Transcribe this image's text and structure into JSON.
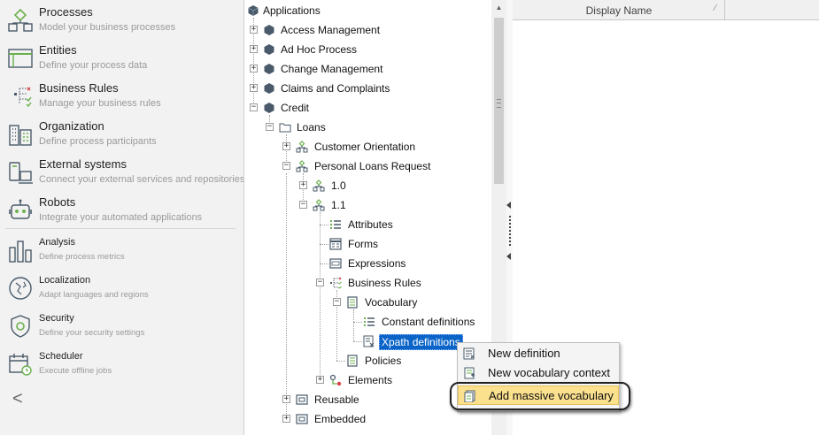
{
  "sidebar": {
    "items": [
      {
        "title": "Processes",
        "subtitle": "Model your business processes",
        "icon": "processes-icon"
      },
      {
        "title": "Entities",
        "subtitle": "Define your process data",
        "icon": "entities-icon"
      },
      {
        "title": "Business Rules",
        "subtitle": "Manage your business rules",
        "icon": "business-rules-icon"
      },
      {
        "title": "Organization",
        "subtitle": "Define process participants",
        "icon": "organization-icon"
      },
      {
        "title": "External systems",
        "subtitle": "Connect your external services and repositories",
        "icon": "external-systems-icon"
      },
      {
        "title": "Robots",
        "subtitle": "Integrate your automated applications",
        "icon": "robot-icon"
      },
      {
        "title": "Analysis",
        "subtitle": "Define process metrics",
        "icon": "analysis-icon"
      },
      {
        "title": "Localization",
        "subtitle": "Adapt languages and regions",
        "icon": "localization-icon"
      },
      {
        "title": "Security",
        "subtitle": "Define your security settings",
        "icon": "security-icon"
      },
      {
        "title": "Scheduler",
        "subtitle": "Execute offline jobs",
        "icon": "scheduler-icon"
      }
    ],
    "collapse_glyph": "<"
  },
  "tree": {
    "nodes": [
      {
        "label": "Applications"
      },
      {
        "label": "Access Management"
      },
      {
        "label": "Ad Hoc Process"
      },
      {
        "label": "Change Management"
      },
      {
        "label": "Claims and Complaints"
      },
      {
        "label": "Credit"
      },
      {
        "label": "Loans"
      },
      {
        "label": "Customer Orientation"
      },
      {
        "label": "Personal Loans Request"
      },
      {
        "label": "1.0"
      },
      {
        "label": "1.1"
      },
      {
        "label": "Attributes"
      },
      {
        "label": "Forms"
      },
      {
        "label": "Expressions"
      },
      {
        "label": "Business Rules"
      },
      {
        "label": "Vocabulary"
      },
      {
        "label": "Constant definitions"
      },
      {
        "label": "Xpath definitions"
      },
      {
        "label": "Policies"
      },
      {
        "label": "Elements"
      },
      {
        "label": "Reusable"
      },
      {
        "label": "Embedded"
      }
    ],
    "expand_plus": "+",
    "expand_minus": "−"
  },
  "grid": {
    "column_header": "Display Name",
    "sort_glyph": "⁄"
  },
  "context_menu": {
    "items": [
      {
        "label": "New definition",
        "icon": "new-definition-icon"
      },
      {
        "label": "New vocabulary context",
        "icon": "new-vocabulary-context-icon"
      },
      {
        "label": "Add massive vocabulary",
        "icon": "add-massive-vocabulary-icon"
      }
    ]
  },
  "colors": {
    "selection": "#0a64c8",
    "menu_highlight": "#fbe08e",
    "icon_green": "#6ab04c",
    "icon_dark": "#4a5a6a"
  }
}
